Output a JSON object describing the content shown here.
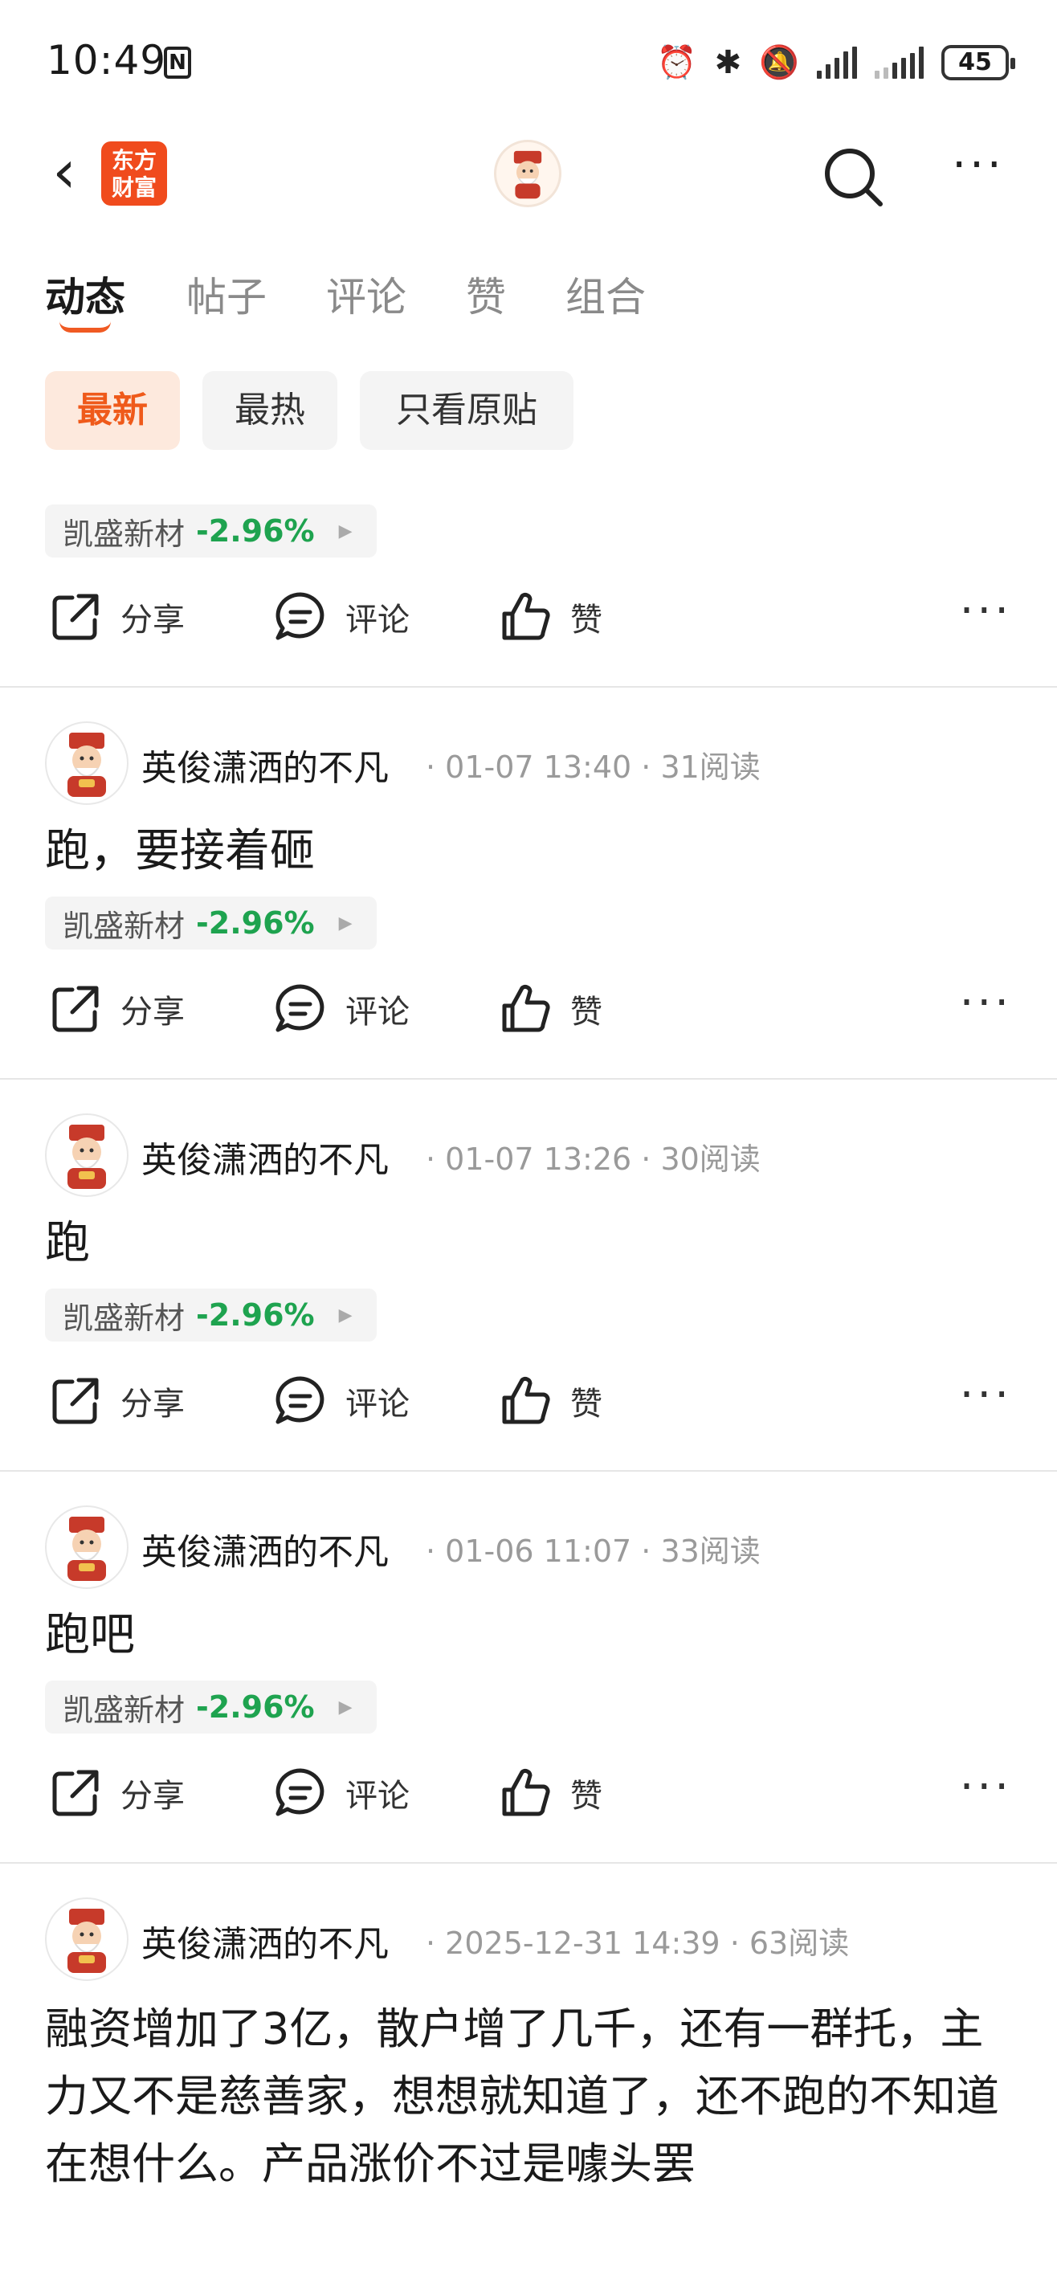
{
  "status_bar": {
    "time": "10:49",
    "nfc": "N",
    "battery": "45",
    "icons": [
      "alarm-icon",
      "bluetooth-icon",
      "mute-icon",
      "signal-icon",
      "signal-icon"
    ]
  },
  "nav": {
    "back_icon": "back-arrow-icon",
    "logo_text_line1": "东方",
    "logo_text_line2": "财富",
    "brand_color": "#f04b1d"
  },
  "tabs": [
    {
      "label": "动态",
      "active": true
    },
    {
      "label": "帖子",
      "active": false
    },
    {
      "label": "评论",
      "active": false
    },
    {
      "label": "赞",
      "active": false
    },
    {
      "label": "组合",
      "active": false
    }
  ],
  "filters": [
    {
      "label": "最新",
      "active": true
    },
    {
      "label": "最热",
      "active": false
    },
    {
      "label": "只看原贴",
      "active": false
    }
  ],
  "actions": {
    "share": "分享",
    "comment": "评论",
    "like": "赞"
  },
  "colors": {
    "accent": "#ef5a1a",
    "down_green": "#1ea34f"
  },
  "posts": [
    {
      "partial": true,
      "stock": {
        "name": "凯盛新材",
        "change": "-2.96%"
      }
    },
    {
      "author": "英俊潇洒的不凡",
      "date": "01-07 13:40",
      "reads": "31阅读",
      "text": "跑，要接着砸",
      "stock": {
        "name": "凯盛新材",
        "change": "-2.96%"
      }
    },
    {
      "author": "英俊潇洒的不凡",
      "date": "01-07 13:26",
      "reads": "30阅读",
      "text": "跑",
      "stock": {
        "name": "凯盛新材",
        "change": "-2.96%"
      }
    },
    {
      "author": "英俊潇洒的不凡",
      "date": "01-06 11:07",
      "reads": "33阅读",
      "text": "跑吧",
      "stock": {
        "name": "凯盛新材",
        "change": "-2.96%"
      }
    },
    {
      "author": "英俊潇洒的不凡",
      "date": "2025-12-31 14:39",
      "reads": "63阅读",
      "text": "融资增加了3亿，散户增了几千，还有一群托，主力又不是慈善家，想想就知道了，还不跑的不知道在想什么。产品涨价不过是噱头罢"
    }
  ]
}
